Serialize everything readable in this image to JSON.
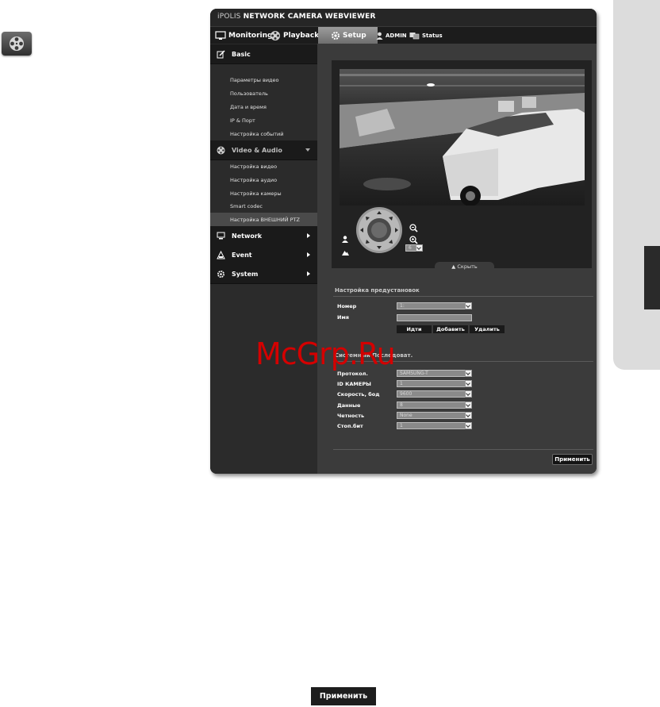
{
  "window": {
    "title_prefix": "iPOLIS",
    "title_main": "NETWORK CAMERA WEBVIEWER"
  },
  "topnav": {
    "monitoring": "Monitoring",
    "playback": "Playback",
    "setup": "Setup",
    "admin": "ADMIN",
    "status": "Status"
  },
  "sidebar": {
    "basic": {
      "label": "Basic",
      "items": [
        "Параметры видео",
        "Пользователь",
        "Дата и время",
        "IP & Порт",
        "Настройка событий"
      ]
    },
    "video_audio": {
      "label": "Video & Audio",
      "items": [
        "Настройка видео",
        "Настройка аудио",
        "Настройка камеры",
        "Smart codec",
        "Настройка ВНЕШНИЙ PTZ"
      ],
      "active_item": "Настройка ВНЕШНИЙ PTZ"
    },
    "network": "Network",
    "event": "Event",
    "system": "System"
  },
  "ptz": {
    "speed_value": "6",
    "hide_label": "▲ Скрыть"
  },
  "preset": {
    "title": "Настройка предустановок",
    "number_label": "Номер",
    "number_value": "1:",
    "name_label": "Имя",
    "go_button": "Идти",
    "add_button": "Добавить",
    "delete_button": "Удалить"
  },
  "serial": {
    "title": "Системный Последоват.",
    "protocol_label": "Протокол.",
    "protocol_value": "SAMSUNG-T",
    "camera_id_label": "ID КАМЕРЫ",
    "camera_id_value": "1",
    "baud_label": "Скорость, бод",
    "baud_value": "9600",
    "data_label": "Данные",
    "data_value": "8",
    "parity_label": "Четность",
    "parity_value": "None",
    "stopbit_label": "Стоп.бит",
    "stopbit_value": "1"
  },
  "apply_button": "Применить",
  "watermark": "McGrp.Ru",
  "bottom_apply_button": "Применить"
}
